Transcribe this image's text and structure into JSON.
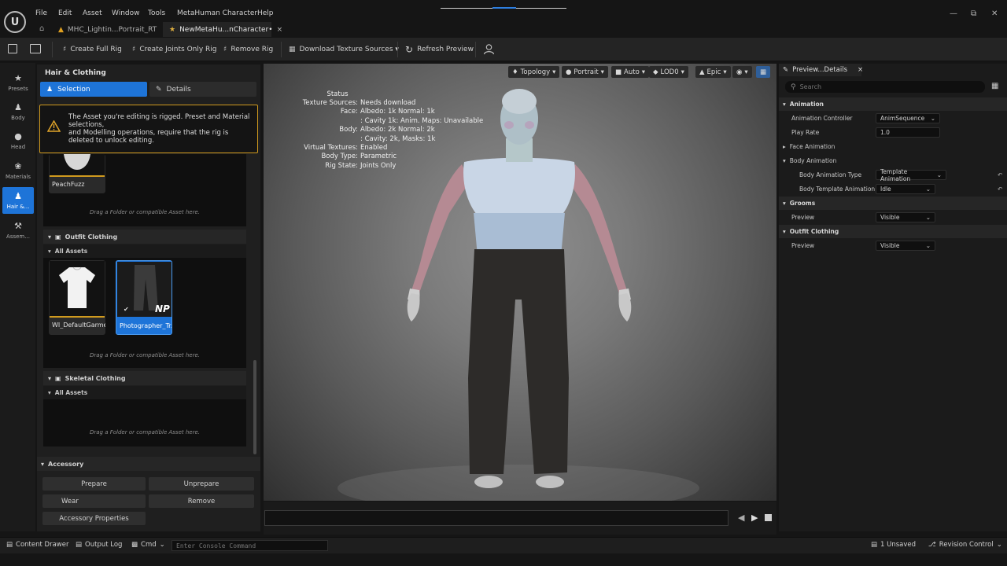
{
  "menu": [
    "File",
    "Edit",
    "Asset",
    "Window",
    "Tools",
    "MetaHuman Character",
    "Help"
  ],
  "tabs": [
    {
      "label": "MHC_Lightin...Portrait_RT"
    },
    {
      "label": "NewMetaHu...nCharacter•"
    }
  ],
  "toolbar": {
    "create_full_rig": "Create Full Rig",
    "create_joints_rig": "Create Joints Only Rig",
    "remove_rig": "Remove Rig",
    "download_textures": "Download Texture Sources ▾",
    "refresh_preview": "Refresh Preview"
  },
  "nav": [
    {
      "label": "Presets"
    },
    {
      "label": "Body"
    },
    {
      "label": "Head"
    },
    {
      "label": "Materials"
    },
    {
      "label": "Hair &..."
    },
    {
      "label": "Assem..."
    }
  ],
  "left_panel": {
    "title": "Hair & Clothing",
    "selection_label": "Selection",
    "details_label": "Details",
    "warning_text": "The Asset you're editing is rigged. Preset and Material selections,\nand Modelling operations, require that the rig is deleted to unlock editing.",
    "peachfuzz_label": "PeachFuzz",
    "drag_hint": "Drag a Folder or compatible Asset here.",
    "outfit_header": "Outfit Clothing",
    "all_assets": "All Assets",
    "assets": [
      {
        "label": "WI_DefaultGarment"
      },
      {
        "label": "Photographer_Tr..."
      }
    ],
    "np_badge": "NP",
    "skeletal_header": "Skeletal Clothing",
    "accessory_header": "Accessory",
    "buttons": {
      "prepare": "Prepare",
      "unprepare": "Unprepare",
      "wear": "Wear",
      "remove": "Remove",
      "properties": "Accessory Properties"
    }
  },
  "viewport": {
    "pills": {
      "topology": "Topology",
      "portrait": "Portrait",
      "auto": "Auto",
      "lod": "LOD0",
      "epic": "Epic"
    },
    "status_title": "Status",
    "status": [
      {
        "key": "Texture Sources:",
        "value": "Needs download"
      },
      {
        "key": "Face:",
        "value": "Albedo: 1k Normal: 1k"
      },
      {
        "key": "",
        "value": ": Cavity 1k: Anim. Maps: Unavailable"
      },
      {
        "key": "Body:",
        "value": "Albedo: 2k Normal: 2k"
      },
      {
        "key": "",
        "value": ": Cavity: 2k, Masks: 1k"
      },
      {
        "key": "Virtual Textures:",
        "value": "Enabled"
      },
      {
        "key": "Body Type:",
        "value": "Parametric"
      },
      {
        "key": "Rig State:",
        "value": "Joints Only"
      }
    ]
  },
  "details": {
    "tab_label": "Preview...Details",
    "search_placeholder": "Search",
    "rows": {
      "animation": "Animation",
      "anim_controller": "Animation Controller",
      "anim_controller_val": "AnimSequence",
      "play_rate": "Play Rate",
      "play_rate_val": "1.0",
      "face_animation": "Face Animation",
      "body_animation": "Body Animation",
      "body_anim_type": "Body Animation Type",
      "body_anim_type_val": "Template Animation",
      "body_template": "Body Template Animation",
      "body_template_val": "Idle",
      "grooms": "Grooms",
      "grooms_preview": "Preview",
      "grooms_preview_val": "Visible",
      "outfit": "Outfit Clothing",
      "outfit_preview": "Preview",
      "outfit_preview_val": "Visible"
    }
  },
  "status_bar": {
    "content_drawer": "Content Drawer",
    "output_log": "Output Log",
    "cmd": "Cmd",
    "console_placeholder": "Enter Console Command",
    "unsaved": "1 Unsaved",
    "revision": "Revision Control"
  },
  "colors": {
    "accent": "#1e74d8",
    "warning": "#d09a1e",
    "panel": "#1f1f1f"
  }
}
